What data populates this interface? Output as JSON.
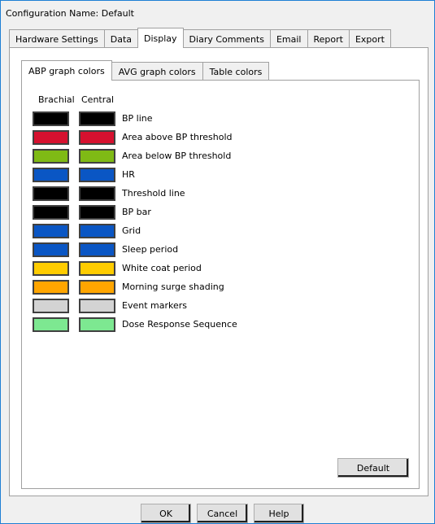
{
  "config_name": "Configuration Name: Default",
  "outer_tabs": [
    {
      "label": "Hardware Settings",
      "active": false
    },
    {
      "label": "Data",
      "active": false
    },
    {
      "label": "Display",
      "active": true
    },
    {
      "label": "Diary Comments",
      "active": false
    },
    {
      "label": "Email",
      "active": false
    },
    {
      "label": "Report",
      "active": false
    },
    {
      "label": "Export",
      "active": false
    }
  ],
  "inner_tabs": [
    {
      "label": "ABP graph colors",
      "active": true
    },
    {
      "label": "AVG graph colors",
      "active": false
    },
    {
      "label": "Table colors",
      "active": false
    }
  ],
  "columns": {
    "brachial": "Brachial",
    "central": "Central"
  },
  "rows": [
    {
      "label": "BP line",
      "brachial": "#000000",
      "central": "#000000"
    },
    {
      "label": "Area above BP threshold",
      "brachial": "#d6112f",
      "central": "#d6112f"
    },
    {
      "label": "Area below BP threshold",
      "brachial": "#7fba15",
      "central": "#7fba15"
    },
    {
      "label": "HR",
      "brachial": "#0a56c4",
      "central": "#0a56c4"
    },
    {
      "label": "Threshold line",
      "brachial": "#000000",
      "central": "#000000"
    },
    {
      "label": "BP bar",
      "brachial": "#000000",
      "central": "#000000"
    },
    {
      "label": "Grid",
      "brachial": "#0a56c4",
      "central": "#0a56c4"
    },
    {
      "label": "Sleep period",
      "brachial": "#0a56c4",
      "central": "#0a56c4"
    },
    {
      "label": "White coat period",
      "brachial": "#ffcc00",
      "central": "#ffcc00"
    },
    {
      "label": "Morning surge shading",
      "brachial": "#ffa500",
      "central": "#ffa500"
    },
    {
      "label": "Event markers",
      "brachial": "#d3d3d3",
      "central": "#d3d3d3"
    },
    {
      "label": "Dose Response Sequence",
      "brachial": "#7de891",
      "central": "#7de891"
    }
  ],
  "buttons": {
    "default": "Default",
    "ok": "OK",
    "cancel": "Cancel",
    "help": "Help"
  }
}
